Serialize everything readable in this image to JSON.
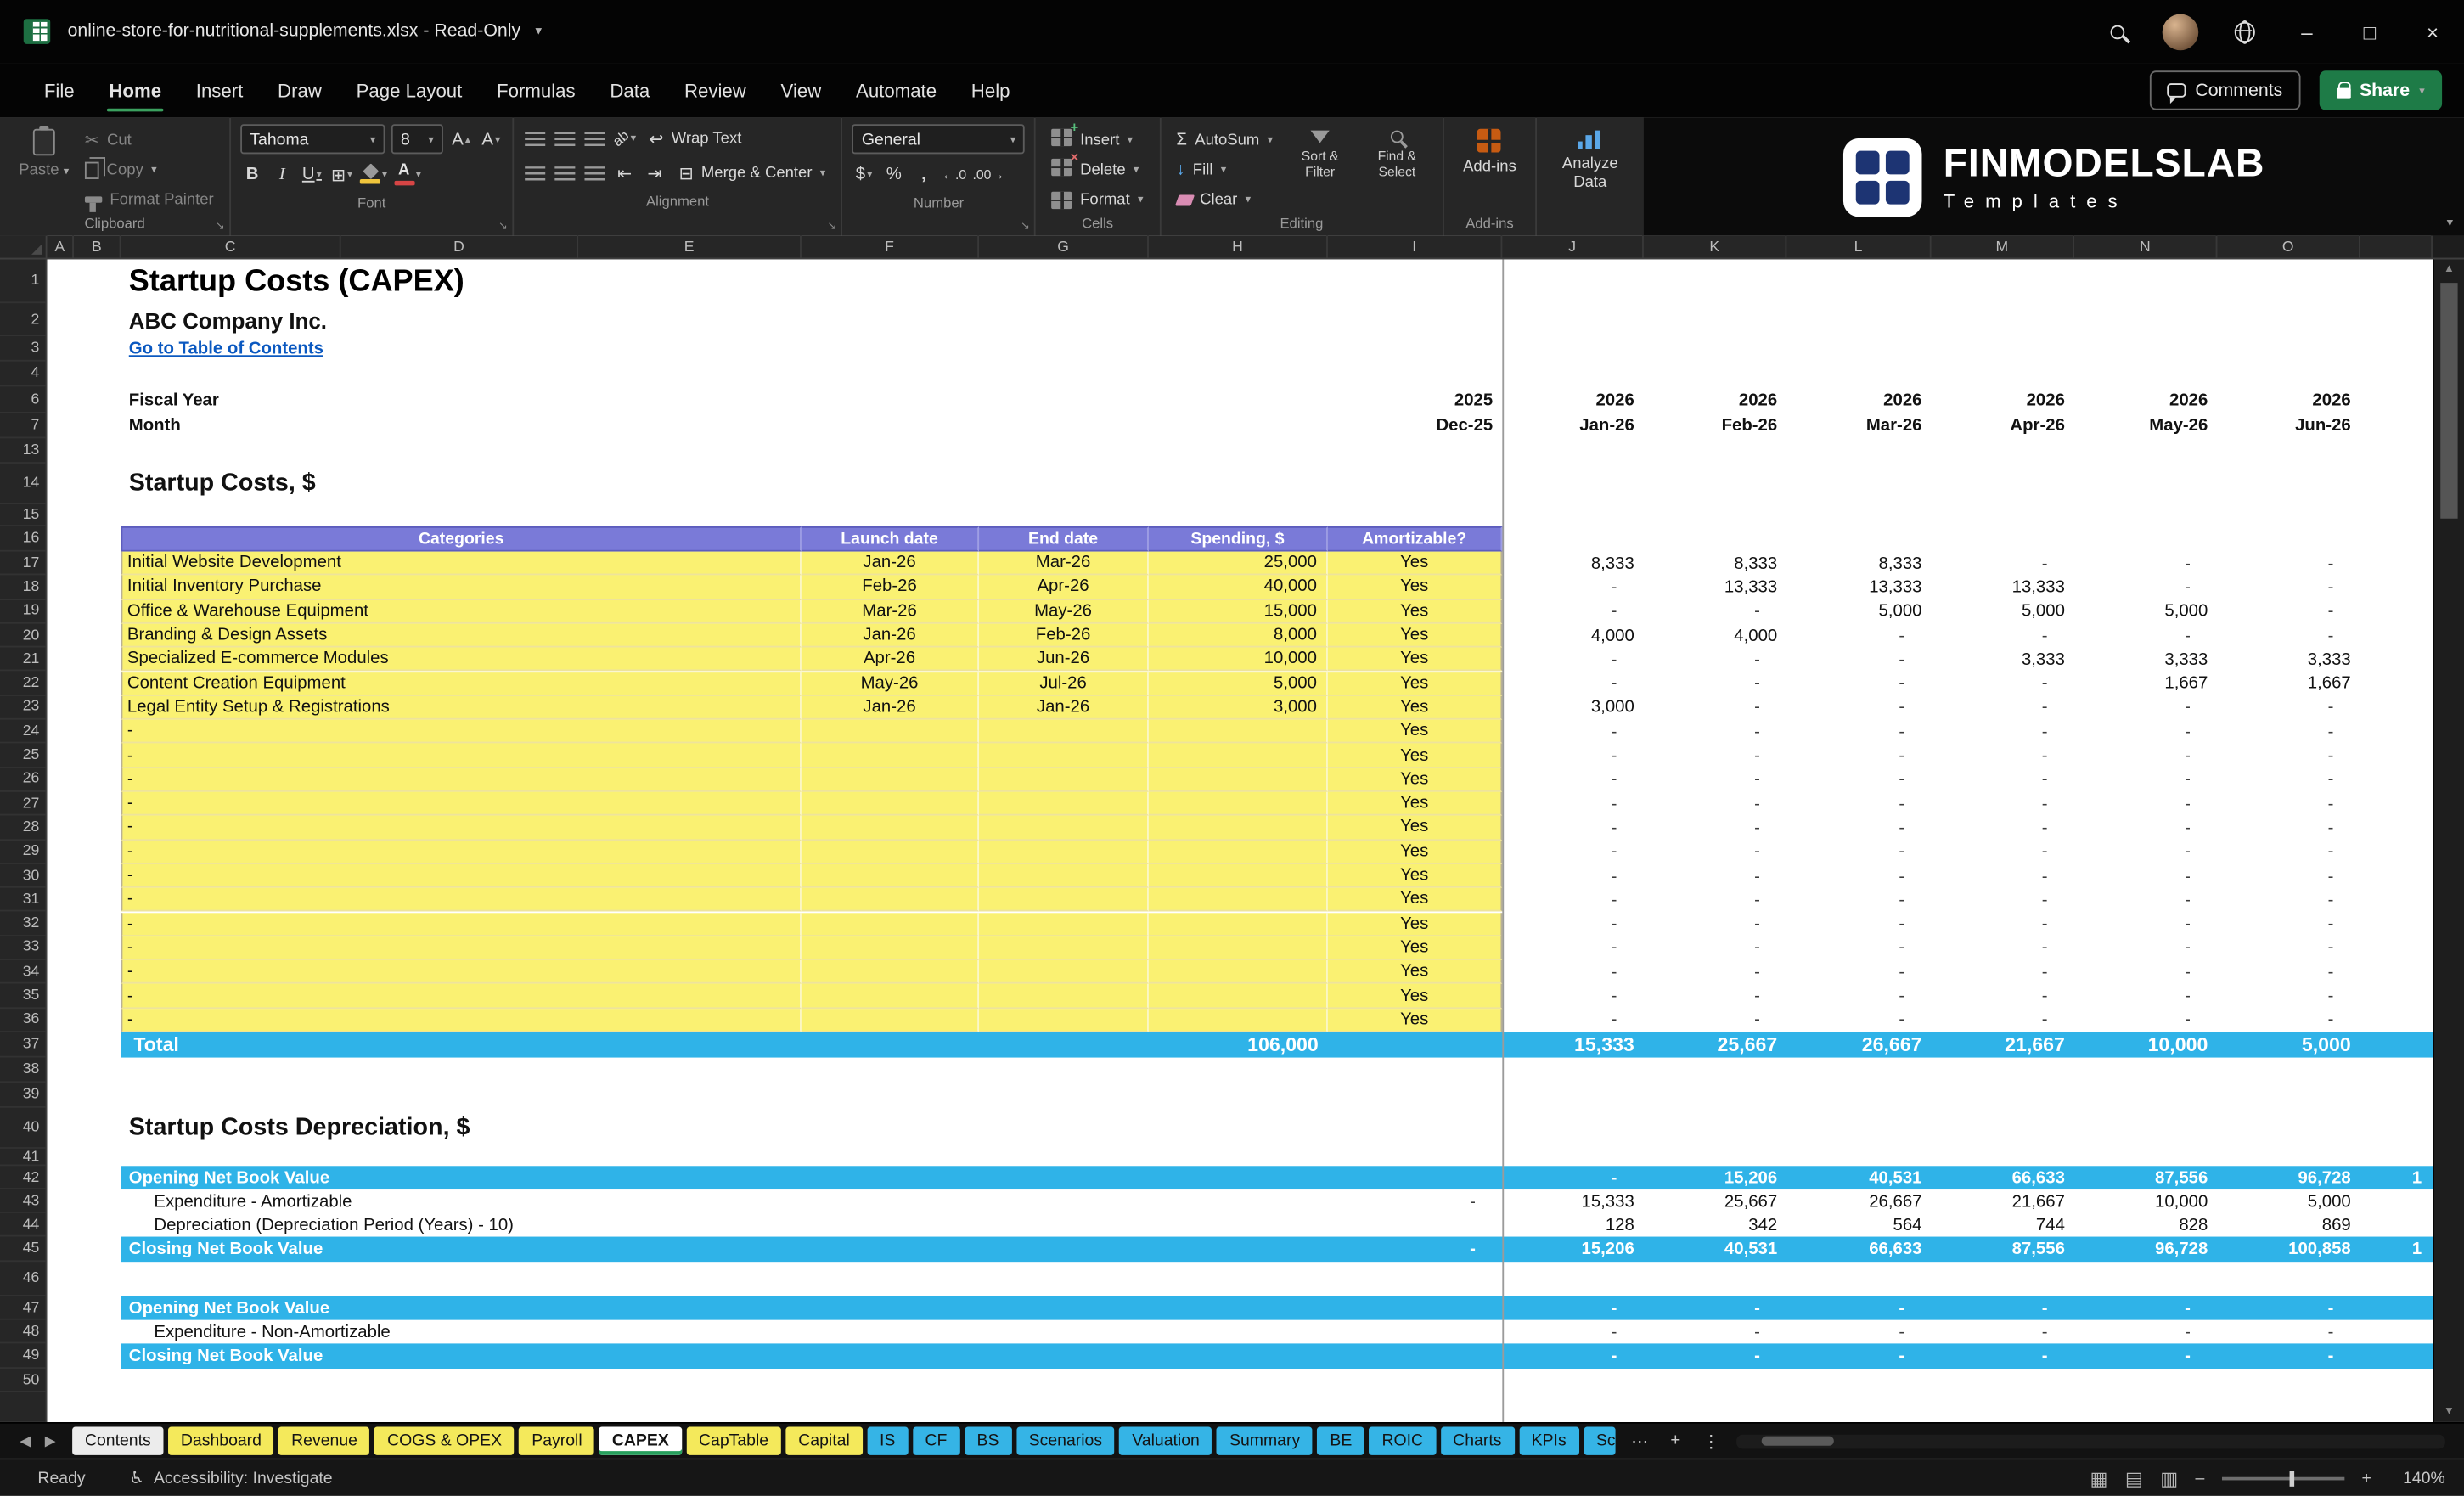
{
  "titlebar": {
    "filename": "online-store-for-nutritional-supplements.xlsx",
    "mode": "Read-Only"
  },
  "menubar": {
    "items": [
      "File",
      "Home",
      "Insert",
      "Draw",
      "Page Layout",
      "Formulas",
      "Data",
      "Review",
      "View",
      "Automate",
      "Help"
    ],
    "active_item": "Home",
    "comments": "Comments",
    "share": "Share"
  },
  "ribbon": {
    "groups": {
      "clipboard": {
        "label": "Clipboard",
        "paste": "Paste",
        "cut": "Cut",
        "copy": "Copy",
        "format_painter": "Format Painter"
      },
      "font": {
        "label": "Font",
        "family": "Tahoma",
        "size": "8"
      },
      "alignment": {
        "label": "Alignment",
        "wrap_text": "Wrap Text",
        "merge_center": "Merge & Center"
      },
      "number": {
        "label": "Number",
        "format": "General"
      },
      "cells": {
        "label": "Cells",
        "insert": "Insert",
        "delete": "Delete",
        "format": "Format"
      },
      "editing": {
        "label": "Editing",
        "autosum": "AutoSum",
        "fill": "Fill",
        "clear": "Clear",
        "sort_filter": "Sort & Filter",
        "find_select": "Find & Select"
      },
      "addins": {
        "label": "Add-ins",
        "button": "Add-ins",
        "analyze": "Analyze Data"
      }
    },
    "logo": {
      "name": "FINMODELSLAB",
      "sub": "Templates"
    }
  },
  "grid": {
    "columns": [
      "A",
      "B",
      "C",
      "D",
      "E",
      "F",
      "G",
      "H",
      "I",
      "J",
      "K",
      "L",
      "M",
      "N",
      "O"
    ],
    "row_numbers": [
      "1",
      "2",
      "3",
      "4",
      "6",
      "7",
      "13",
      "14",
      "15",
      "16",
      "17",
      "18",
      "19",
      "20",
      "21",
      "22",
      "23",
      "24",
      "25",
      "26",
      "27",
      "28",
      "29",
      "30",
      "31",
      "32",
      "33",
      "34",
      "35",
      "36",
      "37",
      "38",
      "39",
      "40",
      "41",
      "42",
      "43",
      "44",
      "45",
      "46",
      "47",
      "48",
      "49",
      "50"
    ]
  },
  "sheet": {
    "title": "Startup Costs (CAPEX)",
    "company": "ABC Company Inc.",
    "toc_link": "Go to Table of Contents",
    "fiscal_year_label": "Fiscal Year",
    "month_label": "Month",
    "fiscal_year_first": "2025",
    "month_first": "Dec-25",
    "fiscal_years": [
      "2026",
      "2026",
      "2026",
      "2026",
      "2026",
      "2026"
    ],
    "months": [
      "Jan-26",
      "Feb-26",
      "Mar-26",
      "Apr-26",
      "May-26",
      "Jun-26"
    ],
    "section_costs_title": "Startup Costs, $",
    "costs_table": {
      "headers": [
        "Categories",
        "Launch date",
        "End date",
        "Spending, $",
        "Amortizable?"
      ],
      "rows": [
        {
          "category": "Initial Website Development",
          "launch": "Jan-26",
          "end": "Mar-26",
          "spending": "25,000",
          "amortizable": "Yes",
          "monthly": [
            "8,333",
            "8,333",
            "8,333",
            "-",
            "-",
            "-"
          ]
        },
        {
          "category": "Initial Inventory Purchase",
          "launch": "Feb-26",
          "end": "Apr-26",
          "spending": "40,000",
          "amortizable": "Yes",
          "monthly": [
            "-",
            "13,333",
            "13,333",
            "13,333",
            "-",
            "-"
          ]
        },
        {
          "category": "Office & Warehouse Equipment",
          "launch": "Mar-26",
          "end": "May-26",
          "spending": "15,000",
          "amortizable": "Yes",
          "monthly": [
            "-",
            "-",
            "5,000",
            "5,000",
            "5,000",
            "-"
          ]
        },
        {
          "category": "Branding & Design Assets",
          "launch": "Jan-26",
          "end": "Feb-26",
          "spending": "8,000",
          "amortizable": "Yes",
          "monthly": [
            "4,000",
            "4,000",
            "-",
            "-",
            "-",
            "-"
          ]
        },
        {
          "category": "Specialized E-commerce Modules",
          "launch": "Apr-26",
          "end": "Jun-26",
          "spending": "10,000",
          "amortizable": "Yes",
          "monthly": [
            "-",
            "-",
            "-",
            "3,333",
            "3,333",
            "3,333"
          ]
        },
        {
          "category": "Content Creation Equipment",
          "launch": "May-26",
          "end": "Jul-26",
          "spending": "5,000",
          "amortizable": "Yes",
          "monthly": [
            "-",
            "-",
            "-",
            "-",
            "1,667",
            "1,667"
          ]
        },
        {
          "category": "Legal Entity Setup & Registrations",
          "launch": "Jan-26",
          "end": "Jan-26",
          "spending": "3,000",
          "amortizable": "Yes",
          "monthly": [
            "3,000",
            "-",
            "-",
            "-",
            "-",
            "-"
          ]
        }
      ],
      "empty_row": {
        "category": "-",
        "launch": "",
        "end": "",
        "spending": "",
        "amortizable": "Yes",
        "monthly": [
          "-",
          "-",
          "-",
          "-",
          "-",
          "-"
        ]
      },
      "empty_row_numbers": [
        "24",
        "25",
        "26",
        "27",
        "28",
        "29",
        "30",
        "31",
        "32",
        "33",
        "34",
        "35",
        "36"
      ],
      "total_label": "Total",
      "total_spending": "106,000",
      "total_monthly": [
        "15,333",
        "25,667",
        "26,667",
        "21,667",
        "10,000",
        "5,000"
      ]
    },
    "section_depr_title": "Startup Costs Depreciation, $",
    "depreciation_block1": [
      {
        "label": "Opening Net Book Value",
        "band": true,
        "dec": "",
        "values": [
          "-",
          "15,206",
          "40,531",
          "66,633",
          "87,556",
          "96,728"
        ],
        "overflow": "1"
      },
      {
        "label": "Expenditure - Amortizable",
        "band": false,
        "dec": "-",
        "values": [
          "15,333",
          "25,667",
          "26,667",
          "21,667",
          "10,000",
          "5,000"
        ],
        "overflow": ""
      },
      {
        "label": "Depreciation (Depreciation Period (Years) - 10)",
        "band": false,
        "dec": "",
        "values": [
          "128",
          "342",
          "564",
          "744",
          "828",
          "869"
        ],
        "overflow": ""
      },
      {
        "label": "Closing Net Book Value",
        "band": true,
        "dec": "-",
        "values": [
          "15,206",
          "40,531",
          "66,633",
          "87,556",
          "96,728",
          "100,858"
        ],
        "overflow": "1"
      }
    ],
    "depreciation_block2": [
      {
        "label": "Opening Net Book Value",
        "band": true,
        "dec": "",
        "values": [
          "-",
          "-",
          "-",
          "-",
          "-",
          "-"
        ],
        "overflow": ""
      },
      {
        "label": "Expenditure - Non-Amortizable",
        "band": false,
        "dec": "",
        "values": [
          "-",
          "-",
          "-",
          "-",
          "-",
          "-"
        ],
        "overflow": ""
      },
      {
        "label": "Closing Net Book Value",
        "band": true,
        "dec": "",
        "values": [
          "-",
          "-",
          "-",
          "-",
          "-",
          "-"
        ],
        "overflow": ""
      }
    ]
  },
  "sheet_tabs": [
    {
      "label": "Contents",
      "style": "light"
    },
    {
      "label": "Dashboard",
      "style": "yellow"
    },
    {
      "label": "Revenue",
      "style": "yellow"
    },
    {
      "label": "COGS & OPEX",
      "style": "yellow"
    },
    {
      "label": "Payroll",
      "style": "yellow"
    },
    {
      "label": "CAPEX",
      "style": "active"
    },
    {
      "label": "CapTable",
      "style": "yellow"
    },
    {
      "label": "Capital",
      "style": "yellow"
    },
    {
      "label": "IS",
      "style": "blue"
    },
    {
      "label": "CF",
      "style": "blue"
    },
    {
      "label": "BS",
      "style": "blue"
    },
    {
      "label": "Scenarios",
      "style": "blue"
    },
    {
      "label": "Valuation",
      "style": "blue"
    },
    {
      "label": "Summary",
      "style": "blue"
    },
    {
      "label": "BE",
      "style": "blue"
    },
    {
      "label": "ROIC",
      "style": "blue"
    },
    {
      "label": "Charts",
      "style": "blue"
    },
    {
      "label": "KPIs",
      "style": "blue"
    },
    {
      "label": "Sc",
      "style": "blue",
      "clipped": true
    }
  ],
  "statusbar": {
    "ready": "Ready",
    "accessibility": "Accessibility: Investigate",
    "zoom": "140%"
  },
  "colors": {
    "table_yellow": "#FAF172",
    "table_header_purple": "#7A7AD8",
    "band_blue": "#2FB3E8",
    "excel_green": "#1D6F42",
    "share_green": "#1E7B47",
    "link_blue": "#0A58C0"
  }
}
